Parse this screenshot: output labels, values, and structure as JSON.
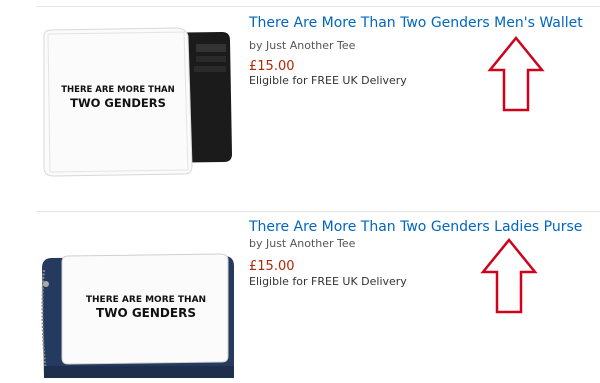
{
  "results": [
    {
      "title": "There Are More Than Two Genders Men's Wallet",
      "byline": "by Just Another Tee",
      "price": "£15.00",
      "delivery": "Eligible for FREE UK Delivery",
      "image_text_line1": "THERE ARE MORE THAN",
      "image_text_line2": "TWO GENDERS",
      "image_icon": "wallet-image"
    },
    {
      "title": "There Are More Than Two Genders Ladies Purse",
      "byline": "by Just Another Tee",
      "price": "£15.00",
      "delivery": "Eligible for FREE UK Delivery",
      "image_text_line1": "THERE ARE MORE THAN",
      "image_text_line2": "TWO GENDERS",
      "image_icon": "purse-image"
    }
  ],
  "annotation": {
    "arrow_icon": "up-arrow-icon",
    "arrow_color": "#d0021b"
  },
  "colors": {
    "link": "#0066c0",
    "price": "#b12704"
  }
}
